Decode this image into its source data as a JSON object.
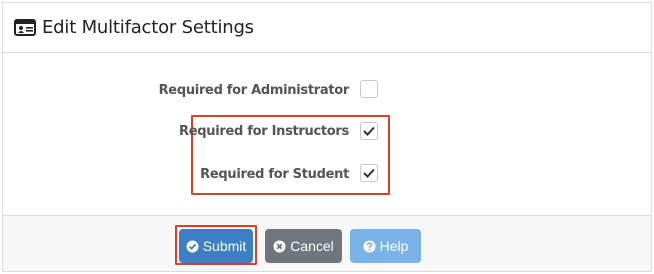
{
  "header": {
    "title": "Edit Multifactor Settings",
    "icon": "id-card-icon"
  },
  "form": {
    "rows": [
      {
        "label": "Required for Administrator",
        "checked": false
      },
      {
        "label": "Required for Instructors",
        "checked": true
      },
      {
        "label": "Required for Student",
        "checked": true
      }
    ]
  },
  "footer": {
    "submit_label": "Submit",
    "cancel_label": "Cancel",
    "help_label": "Help"
  },
  "colors": {
    "highlight": "#d4432a",
    "submit": "#3c7fc4",
    "cancel": "#6f767d",
    "help": "#7ab3e8"
  }
}
